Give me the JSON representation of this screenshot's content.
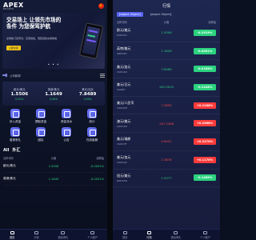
{
  "left": {
    "logo": "APEX",
    "logo_sub": "BROKER",
    "banner": {
      "title": "交易场上 让领先市场的条件 为您保驾护航",
      "subtitle": "全球热门货币对，高流动性，低延迟的交易体验",
      "cta": "立即交易"
    },
    "notice": "公司新闻",
    "quotes": [
      {
        "name": "欧元/美元",
        "price": "1.5506",
        "change": "0.00%"
      },
      {
        "name": "英镑/美元",
        "price": "1.1649",
        "change": "0.00%"
      },
      {
        "name": "美元/加元",
        "price": "7.8489",
        "change": "0.00%"
      }
    ],
    "grid": [
      {
        "label": "存入资金"
      },
      {
        "label": "提取资金"
      },
      {
        "label": "资金流水"
      },
      {
        "label": "统计"
      },
      {
        "label": "邀请有礼"
      },
      {
        "label": "团队"
      },
      {
        "label": "公告"
      },
      {
        "label": "在线客服"
      }
    ],
    "section": {
      "all": "All",
      "title": "外汇"
    },
    "table_header": {
      "name": "名称代码",
      "price": "价格",
      "change": "涨跌幅"
    },
    "rows": [
      {
        "name": "欧元/美元",
        "price": "1.5506",
        "change": "-0.0091%"
      },
      {
        "name": "英镑/美元",
        "price": "1.1649",
        "change": "-0.0051%"
      }
    ],
    "tabs": [
      {
        "label": "首页",
        "icon": "home-icon"
      },
      {
        "label": "行情",
        "icon": "chart-icon"
      },
      {
        "label": "邀请有礼",
        "icon": "gift-icon"
      },
      {
        "label": "个人账户",
        "icon": "user-icon"
      }
    ]
  },
  "right": {
    "title": "行情",
    "tabs": [
      {
        "label": "首页",
        "icon": "home-icon"
      },
      {
        "label": "行情",
        "icon": "chart-icon"
      },
      {
        "label": "邀请有礼",
        "icon": "gift-icon"
      },
      {
        "label": "个人账户",
        "icon": "user-icon"
      }
    ],
    "table_header": {
      "name": "名称代码",
      "price": "价格",
      "change": "涨跌幅"
    },
    "rows": [
      {
        "name": "欧元/美元",
        "code": "EURUSD",
        "price": "1.5506",
        "change": "-0.2919%",
        "dir": "up"
      },
      {
        "name": "英镑/美元",
        "code": "GBPUSD",
        "price": "1.1649",
        "change": "-0.0051%",
        "dir": "up"
      },
      {
        "name": "美元/加元",
        "code": "USDCAD",
        "price": "7.8489",
        "change": "-0.0188%",
        "dir": "up"
      },
      {
        "name": "美元/日元",
        "code": "USDJPY",
        "price": "161.0025",
        "change": "-0.1248%",
        "dir": "up"
      },
      {
        "name": "美元/人民币",
        "code": "USDCNH",
        "price": "7.2850",
        "change": "+0.2168%",
        "dir": "dn"
      },
      {
        "name": "澳元/美元",
        "code": "AUDUSD",
        "price": "147.2458",
        "change": "+0.2568%",
        "dir": "dn"
      },
      {
        "name": "美元/瑞郎",
        "code": "USDCHF",
        "price": "0.9021",
        "change": "+0.3170%",
        "dir": "dn"
      },
      {
        "name": "美元/加元",
        "code": "USDCAD",
        "price": "1.3678",
        "change": "+0.1170%",
        "dir": "dn"
      },
      {
        "name": "纽元/美元",
        "code": "NZDUSD",
        "price": "1.5377",
        "change": "-0.1489%",
        "dir": "up"
      }
    ]
  },
  "colors": {
    "up": "#2bd27f",
    "down": "#ff3b3b",
    "accent": "#5865f2"
  }
}
